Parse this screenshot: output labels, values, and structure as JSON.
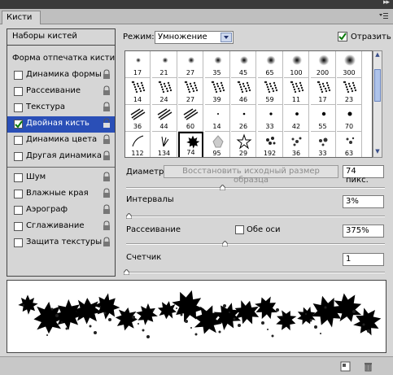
{
  "window": {
    "tab": "Кисти"
  },
  "left_panel": {
    "header": "Наборы кистей",
    "tip_shape": "Форма отпечатка кисти",
    "items": [
      {
        "label": "Динамика формы",
        "checked": false,
        "active": false
      },
      {
        "label": "Рассеивание",
        "checked": false,
        "active": false
      },
      {
        "label": "Текстура",
        "checked": false,
        "active": false
      },
      {
        "label": "Двойная кисть",
        "checked": true,
        "active": true
      },
      {
        "label": "Динамика цвета",
        "checked": false,
        "active": false
      },
      {
        "label": "Другая динамика",
        "checked": false,
        "active": false
      },
      {
        "label": "Шум",
        "checked": false,
        "active": false
      },
      {
        "label": "Влажные края",
        "checked": false,
        "active": false
      },
      {
        "label": "Аэрограф",
        "checked": false,
        "active": false
      },
      {
        "label": "Сглаживание",
        "checked": false,
        "active": false
      },
      {
        "label": "Защита текстуры",
        "checked": false,
        "active": false
      }
    ]
  },
  "mode": {
    "label": "Режим:",
    "value": "Умножение"
  },
  "flip": {
    "label": "Отразить",
    "checked": true
  },
  "brush_grid": {
    "sizes": [
      [
        "17",
        "21",
        "27",
        "35",
        "45",
        "65",
        "100",
        "200",
        "300"
      ],
      [
        "14",
        "24",
        "27",
        "39",
        "46",
        "59",
        "11",
        "17",
        "23"
      ],
      [
        "36",
        "44",
        "60",
        "14",
        "26",
        "33",
        "42",
        "55",
        "70"
      ],
      [
        "112",
        "134",
        "74",
        "95",
        "29",
        "192",
        "36",
        "33",
        "63"
      ]
    ],
    "selected": "74"
  },
  "settings": {
    "diameter_label": "Диаметр",
    "restore_button": "Восстановить исходный размер образца",
    "diameter_value": "74 пикс.",
    "spacing_label": "Интервалы",
    "spacing_value": "3%",
    "scatter_label": "Рассеивание",
    "both_axes_label": "Обе оси",
    "scatter_value": "375%",
    "count_label": "Счетчик",
    "count_value": "1"
  },
  "sliders": {
    "diameter": 0.37,
    "spacing": 0.01,
    "scatter": 0.38,
    "count": 0.0
  }
}
